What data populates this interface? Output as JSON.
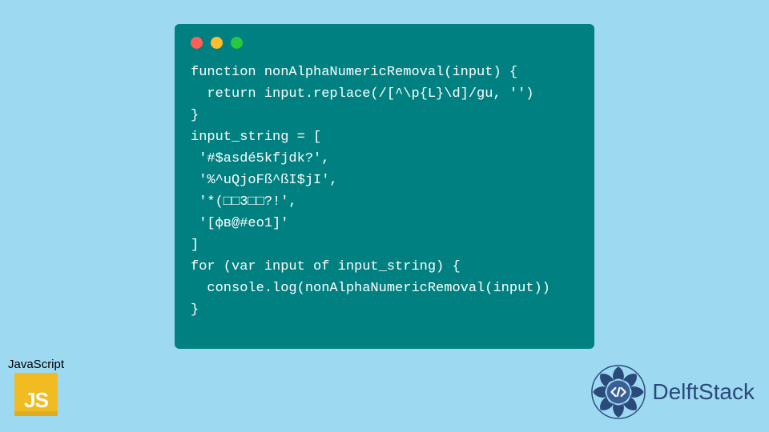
{
  "code": {
    "lines": [
      "function nonAlphaNumericRemoval(input) {",
      "  return input.replace(/[^\\p{L}\\d]/gu, '')",
      "}",
      "input_string = [",
      " '#$asdé5kfjdk?',",
      " '%^uQjoFß^ßI$jI',",
      " '*(□□3□□?!',",
      " '[фв@#еo1]'",
      "]",
      "for (var input of input_string) {",
      "  console.log(nonAlphaNumericRemoval(input))",
      "}"
    ]
  },
  "jsBadge": {
    "label": "JavaScript",
    "logoText": "JS"
  },
  "brand": {
    "name": "DelftStack"
  },
  "colors": {
    "pageBg": "#9ed9f2",
    "windowBg": "#008080",
    "brand": "#2a4a7a",
    "jsYellow": "#f0bc22"
  }
}
